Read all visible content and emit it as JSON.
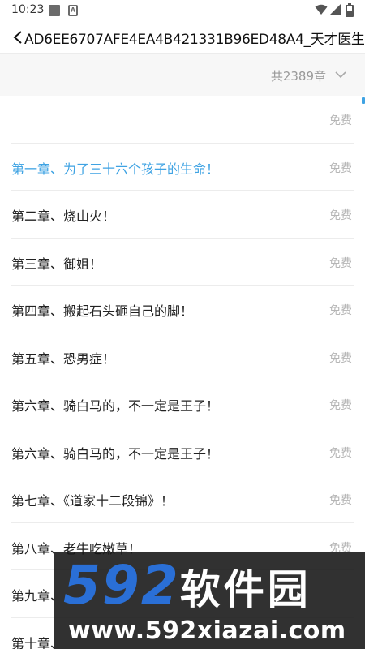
{
  "status_bar": {
    "time": "10:23",
    "notif_a_label": "A"
  },
  "header": {
    "title": "AD6EE6707AFE4EA4B421331B96ED48A4_天才医生"
  },
  "toc": {
    "count_label": "共2389章"
  },
  "chapters": [
    {
      "title": "",
      "badge": "免费",
      "active": false
    },
    {
      "title": "第一章、为了三十六个孩子的生命！",
      "badge": "免费",
      "active": true
    },
    {
      "title": "第二章、烧山火！",
      "badge": "免费",
      "active": false
    },
    {
      "title": "第三章、御姐！",
      "badge": "免费",
      "active": false
    },
    {
      "title": "第四章、搬起石头砸自己的脚！",
      "badge": "免费",
      "active": false
    },
    {
      "title": "第五章、恐男症！",
      "badge": "免费",
      "active": false
    },
    {
      "title": "第六章、骑白马的，不一定是王子！",
      "badge": "免费",
      "active": false
    },
    {
      "title": "第六章、骑白马的，不一定是王子！",
      "badge": "免费",
      "active": false
    },
    {
      "title": "第七章、《道家十二段锦》！",
      "badge": "免费",
      "active": false
    },
    {
      "title": "第八章、老牛吃嫩草！",
      "badge": "免费",
      "active": false
    },
    {
      "title": "第九章、",
      "badge": "",
      "active": false
    },
    {
      "title": "第十章、",
      "badge": "",
      "active": false
    }
  ],
  "watermark": {
    "logo_num": "592",
    "logo_cn": "软件园",
    "url": "www.592xiazai.com"
  },
  "colors": {
    "accent": "#3fa3e3",
    "muted": "#b5b5b5"
  }
}
